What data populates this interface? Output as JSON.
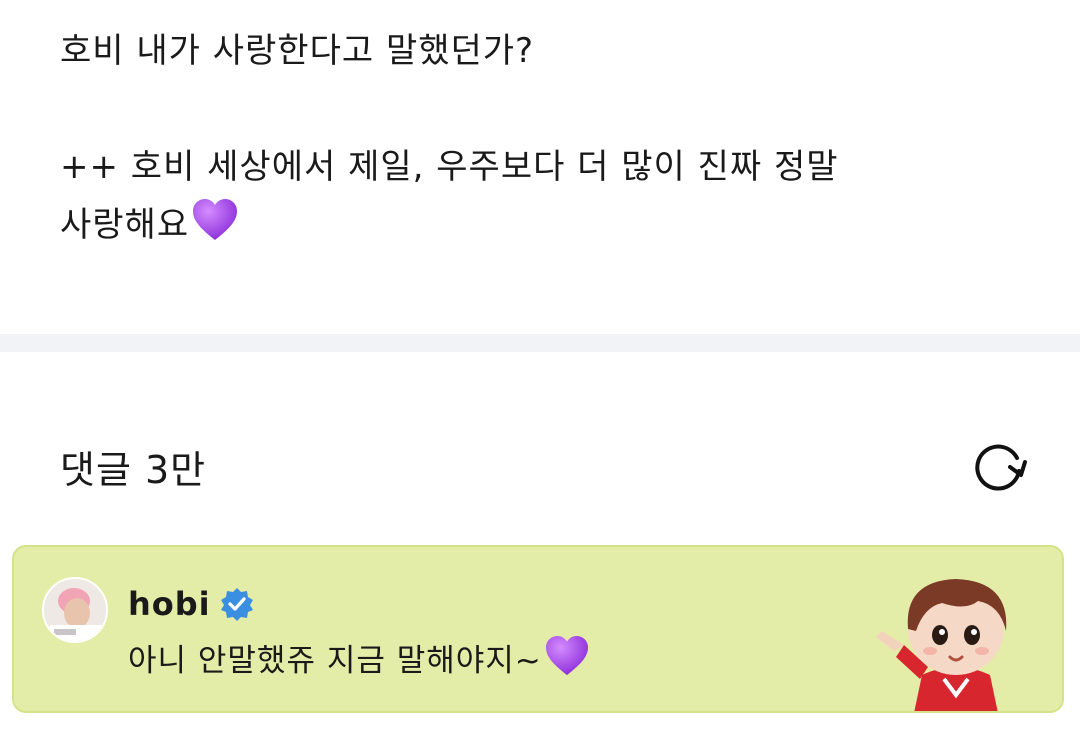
{
  "post": {
    "line1": "호비 내가 사랑한다고 말했던가?",
    "line2": "++ 호비 세상에서 제일, 우주보다 더 많이 진짜 정말",
    "line3": "사랑해요",
    "heart_icon": "purple-heart"
  },
  "comments": {
    "title": "댓글 3만",
    "refresh_icon": "refresh-icon",
    "featured": {
      "author": "hobi",
      "verified_icon": "verified-badge",
      "text": "아니 안말했쥬 지금 말해야지~",
      "heart_icon": "purple-heart",
      "background": "#e4eda8"
    }
  },
  "colors": {
    "verified": "#3b8fe0",
    "heart": "#9b3fe0",
    "divider": "#f2f3f6"
  }
}
